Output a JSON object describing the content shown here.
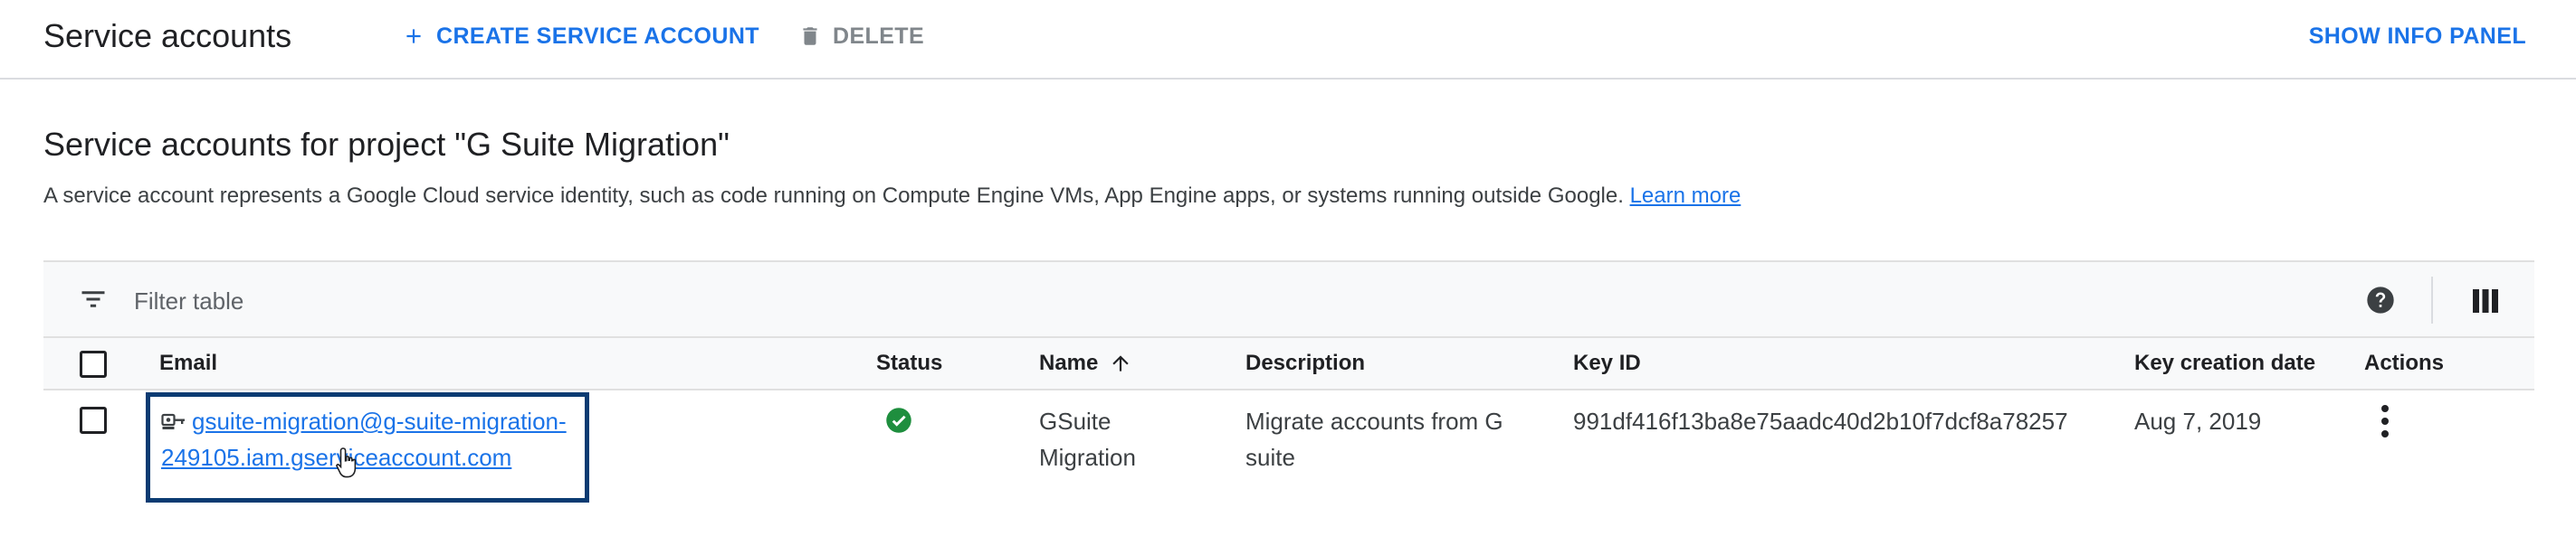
{
  "header": {
    "title": "Service accounts",
    "create_label": "CREATE SERVICE ACCOUNT",
    "delete_label": "DELETE",
    "info_panel_label": "SHOW INFO PANEL"
  },
  "section": {
    "title": "Service accounts for project \"G Suite Migration\"",
    "description": "A service account represents a Google Cloud service identity, such as code running on Compute Engine VMs, App Engine apps, or systems running outside Google.",
    "learn_more": "Learn more"
  },
  "table": {
    "filter_placeholder": "Filter table",
    "columns": {
      "email": "Email",
      "status": "Status",
      "name": "Name",
      "description": "Description",
      "key_id": "Key ID",
      "key_creation_date": "Key creation date",
      "actions": "Actions"
    },
    "sort_indicator": "name ascending",
    "rows": [
      {
        "email": "gsuite-migration@g-suite-migration-249105.iam.gserviceaccount.com",
        "status_icon": "check-circle-icon",
        "name": "GSuite Migration",
        "description": "Migrate accounts from G suite",
        "key_id": "991df416f13ba8e75aadc40d2b10f7dcf8a78257",
        "key_creation_date": "Aug 7, 2019"
      }
    ]
  },
  "colors": {
    "accent": "#1a73e8",
    "status_ok": "#1e8e3e",
    "highlight_border": "#0b3b72",
    "muted": "#80868b"
  }
}
